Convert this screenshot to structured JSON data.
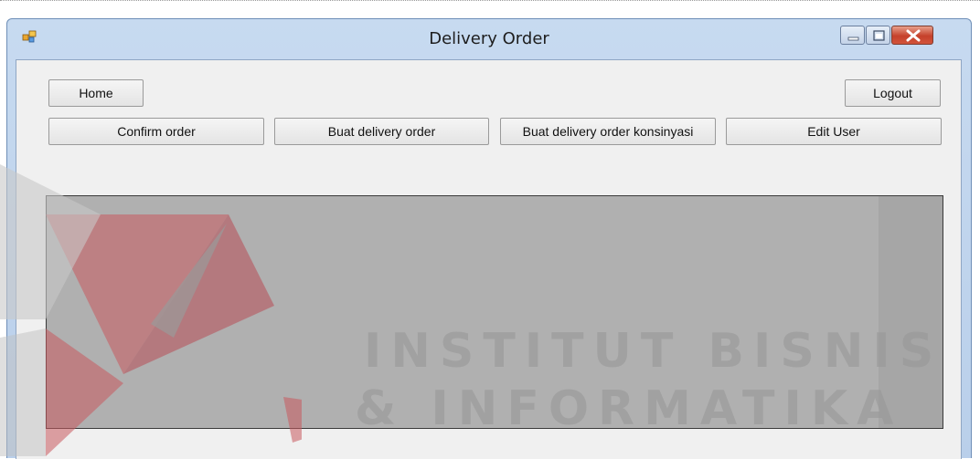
{
  "window": {
    "title": "Delivery Order",
    "icon": "app-icon",
    "controls": [
      "minimize-icon",
      "maximize-icon",
      "close-icon"
    ]
  },
  "toolbar": {
    "home_label": "Home",
    "logout_label": "Logout",
    "confirm_order_label": "Confirm order",
    "buat_delivery_order_label": "Buat delivery order",
    "buat_delivery_order_konsinyasi_label": "Buat delivery order konsinyasi",
    "edit_user_label": "Edit User"
  },
  "watermark": {
    "line1": "INSTITUT BISNIS",
    "line2": "& INFORMATIKA"
  },
  "colors": {
    "window_frame": "#b9cfea",
    "client_bg": "#f0f0f0",
    "grid_bg": "#b0b0b0",
    "close_button": "#c5412b",
    "watermark_red": "#c8595e"
  }
}
